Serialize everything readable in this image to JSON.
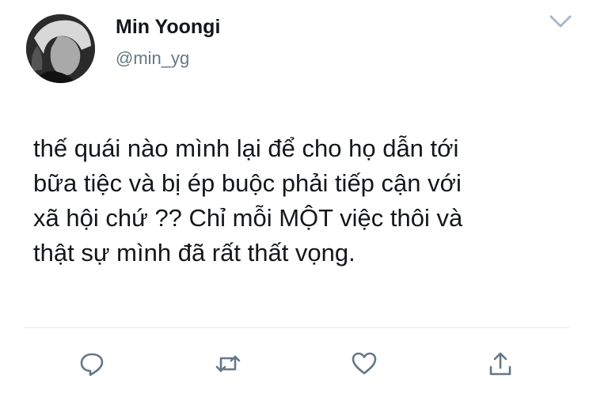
{
  "tweet": {
    "display_name": "Min Yoongi",
    "handle": "@min_yg",
    "text_lines": [
      "thế quái nào mình lại để cho họ dẫn tới",
      "bữa tiệc và bị ép buộc phải tiếp cận với",
      "xã hội chứ ?? Chỉ mỗi MỘT việc thôi và",
      "thật sự mình đã rất thất vọng."
    ]
  },
  "icons": {
    "menu": "chevron-down-icon",
    "reply": "reply-icon",
    "retweet": "retweet-icon",
    "like": "heart-icon",
    "share": "share-icon"
  },
  "colors": {
    "text": "#14171a",
    "secondary": "#657786",
    "icon": "#657786",
    "divider": "#e1e8ed",
    "chevron": "#aab8c2"
  }
}
